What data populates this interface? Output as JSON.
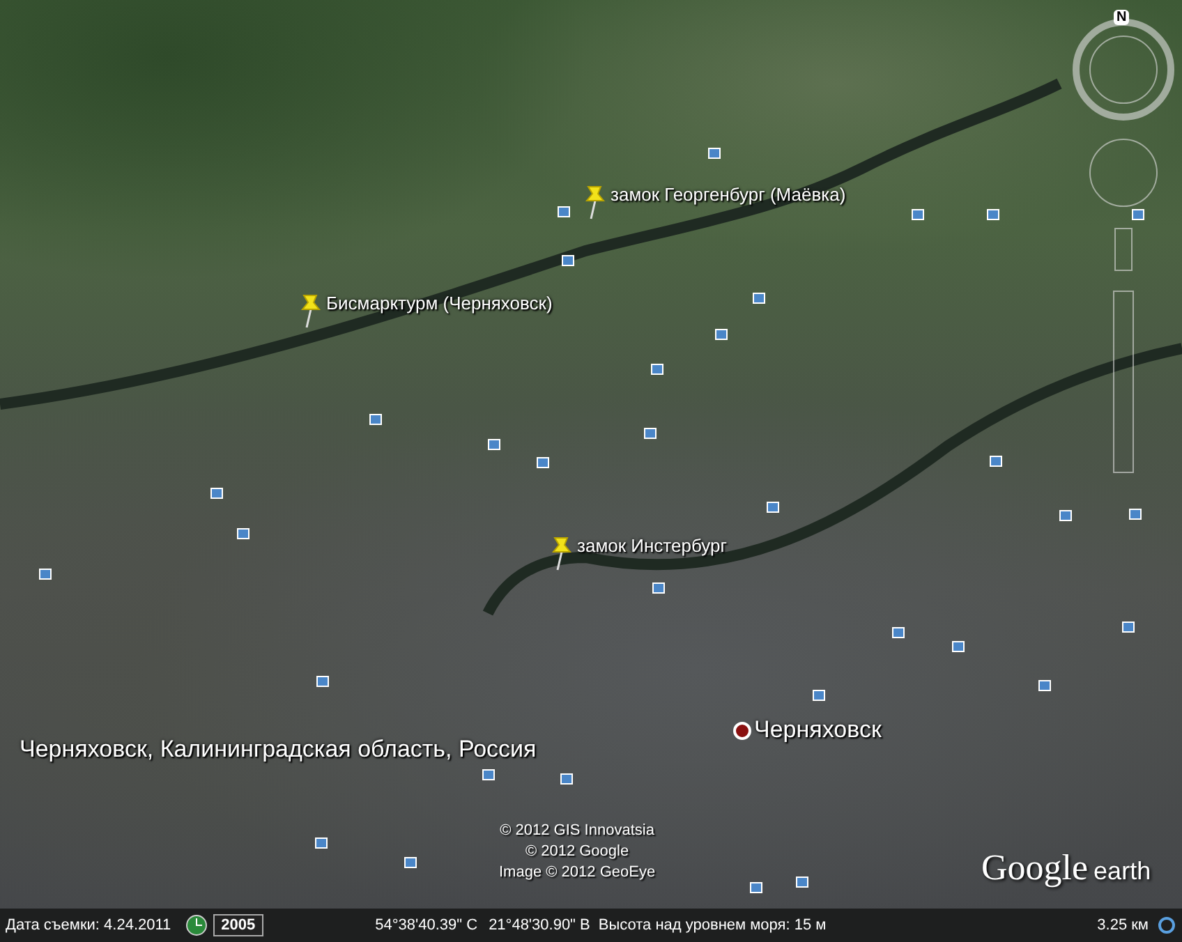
{
  "map": {
    "places": [
      {
        "kind": "placemark",
        "label": "замок Георгенбург (Маёвка)"
      },
      {
        "kind": "placemark",
        "label": "Бисмарктурм (Черняховск)"
      },
      {
        "kind": "placemark",
        "label": "замок Инстербург"
      },
      {
        "kind": "city",
        "label": "Черняховск"
      },
      {
        "kind": "region",
        "label": "Черняховск, Калининградская область, Россия"
      }
    ],
    "compass": {
      "north": "N"
    },
    "attribution": [
      "© 2012 GIS Innovatsia",
      "© 2012 Google",
      "Image © 2012 GeoEye"
    ],
    "logo": {
      "brand": "Google",
      "product": "earth"
    }
  },
  "status_bar": {
    "imagery_date": "Дата съемки: 4.24.2011",
    "historical_year": "2005",
    "latitude": "54°38'40.39\" С",
    "longitude": "21°48'30.90\" В",
    "elevation": "Высота над уровнем моря: 15 м",
    "eye_altitude": "3.25 км"
  }
}
